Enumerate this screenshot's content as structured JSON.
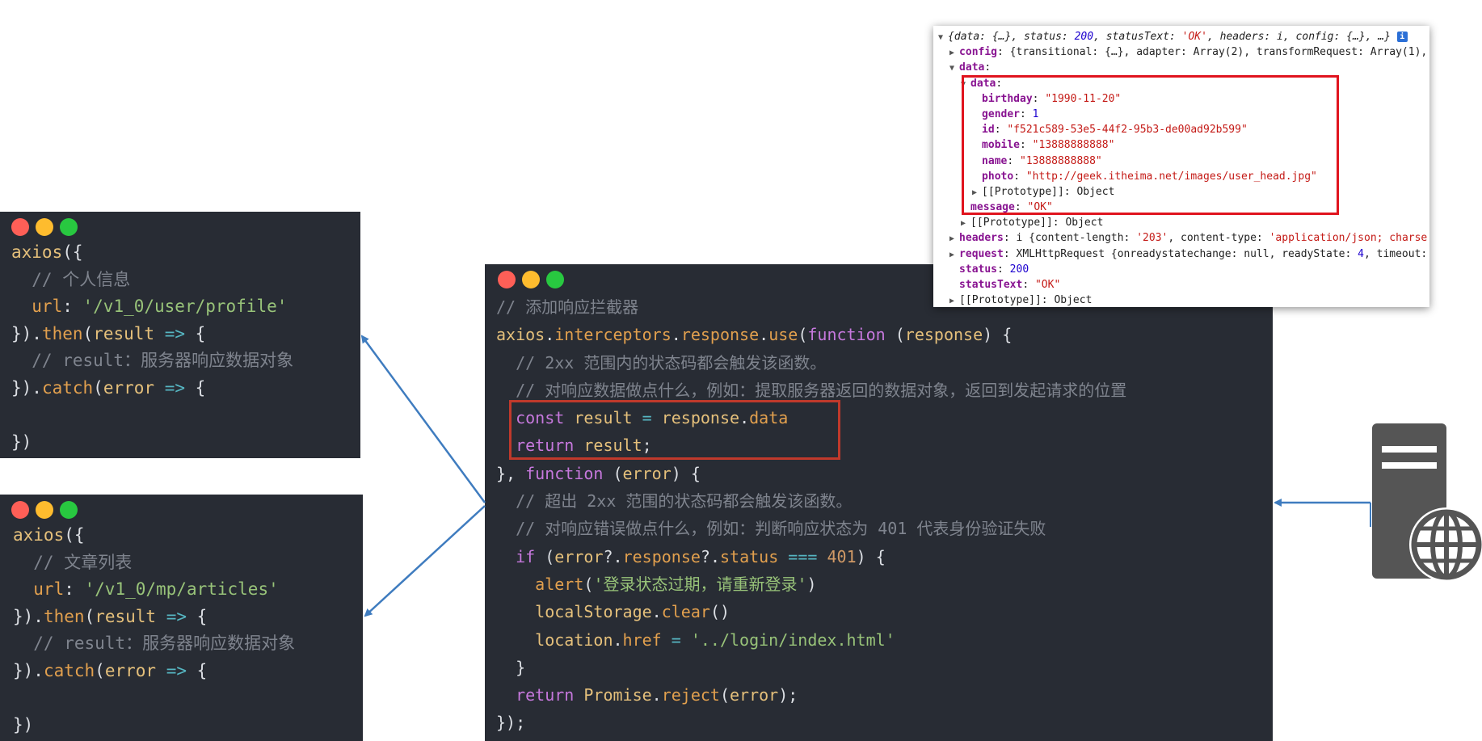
{
  "code_top": [
    [
      {
        "t": "axios",
        "c": "yellow"
      },
      {
        "t": "({",
        "c": "white"
      }
    ],
    [
      {
        "t": "  // 个人信息",
        "c": "comment"
      }
    ],
    [
      {
        "t": "  url",
        "c": "orange"
      },
      {
        "t": ": ",
        "c": "white"
      },
      {
        "t": "'/v1_0/user/profile'",
        "c": "green"
      }
    ],
    [
      {
        "t": "})",
        "c": "white"
      },
      {
        "t": ".",
        "c": "white"
      },
      {
        "t": "then",
        "c": "orange"
      },
      {
        "t": "(",
        "c": "white"
      },
      {
        "t": "result",
        "c": "yellow"
      },
      {
        "t": " => ",
        "c": "cyan"
      },
      {
        "t": "{",
        "c": "white"
      }
    ],
    [
      {
        "t": "  // result：服务器响应数据对象",
        "c": "comment"
      }
    ],
    [
      {
        "t": "})",
        "c": "white"
      },
      {
        "t": ".",
        "c": "white"
      },
      {
        "t": "catch",
        "c": "orange"
      },
      {
        "t": "(",
        "c": "white"
      },
      {
        "t": "error",
        "c": "yellow"
      },
      {
        "t": " => ",
        "c": "cyan"
      },
      {
        "t": "{",
        "c": "white"
      }
    ],
    [
      {
        "t": " ",
        "c": "white"
      }
    ],
    [
      {
        "t": "})",
        "c": "white"
      }
    ]
  ],
  "code_bottom": [
    [
      {
        "t": "axios",
        "c": "yellow"
      },
      {
        "t": "({",
        "c": "white"
      }
    ],
    [
      {
        "t": "  // 文章列表",
        "c": "comment"
      }
    ],
    [
      {
        "t": "  url",
        "c": "orange"
      },
      {
        "t": ": ",
        "c": "white"
      },
      {
        "t": "'/v1_0/mp/articles'",
        "c": "green"
      }
    ],
    [
      {
        "t": "})",
        "c": "white"
      },
      {
        "t": ".",
        "c": "white"
      },
      {
        "t": "then",
        "c": "orange"
      },
      {
        "t": "(",
        "c": "white"
      },
      {
        "t": "result",
        "c": "yellow"
      },
      {
        "t": " => ",
        "c": "cyan"
      },
      {
        "t": "{",
        "c": "white"
      }
    ],
    [
      {
        "t": "  // result：服务器响应数据对象",
        "c": "comment"
      }
    ],
    [
      {
        "t": "})",
        "c": "white"
      },
      {
        "t": ".",
        "c": "white"
      },
      {
        "t": "catch",
        "c": "orange"
      },
      {
        "t": "(",
        "c": "white"
      },
      {
        "t": "error",
        "c": "yellow"
      },
      {
        "t": " => ",
        "c": "cyan"
      },
      {
        "t": "{",
        "c": "white"
      }
    ],
    [
      {
        "t": " ",
        "c": "white"
      }
    ],
    [
      {
        "t": "})",
        "c": "white"
      }
    ]
  ],
  "code_main": [
    [
      {
        "t": "// 添加响应拦截器",
        "c": "comment"
      }
    ],
    [
      {
        "t": "axios",
        "c": "yellow"
      },
      {
        "t": ".",
        "c": "white"
      },
      {
        "t": "interceptors",
        "c": "orange"
      },
      {
        "t": ".",
        "c": "white"
      },
      {
        "t": "response",
        "c": "orange"
      },
      {
        "t": ".",
        "c": "white"
      },
      {
        "t": "use",
        "c": "orange"
      },
      {
        "t": "(",
        "c": "white"
      },
      {
        "t": "function",
        "c": "purple"
      },
      {
        "t": " (",
        "c": "white"
      },
      {
        "t": "response",
        "c": "yellow"
      },
      {
        "t": ") {",
        "c": "white"
      }
    ],
    [
      {
        "t": "  // 2xx 范围内的状态码都会触发该函数。",
        "c": "comment"
      }
    ],
    [
      {
        "t": "  // 对响应数据做点什么，例如：提取服务器返回的数据对象，返回到发起请求的位置",
        "c": "comment"
      }
    ],
    [
      {
        "t": "  ",
        "c": "white"
      },
      {
        "t": "const",
        "c": "purple"
      },
      {
        "t": " result ",
        "c": "yellow"
      },
      {
        "t": "=",
        "c": "cyan"
      },
      {
        "t": " response",
        "c": "yellow"
      },
      {
        "t": ".",
        "c": "white"
      },
      {
        "t": "data",
        "c": "orange"
      }
    ],
    [
      {
        "t": "  ",
        "c": "white"
      },
      {
        "t": "return",
        "c": "purple"
      },
      {
        "t": " result",
        "c": "yellow"
      },
      {
        "t": ";",
        "c": "white"
      }
    ],
    [
      {
        "t": "}, ",
        "c": "white"
      },
      {
        "t": "function",
        "c": "purple"
      },
      {
        "t": " (",
        "c": "white"
      },
      {
        "t": "error",
        "c": "yellow"
      },
      {
        "t": ") {",
        "c": "white"
      }
    ],
    [
      {
        "t": "  // 超出 2xx 范围的状态码都会触发该函数。",
        "c": "comment"
      }
    ],
    [
      {
        "t": "  // 对响应错误做点什么，例如：判断响应状态为 401 代表身份验证失败",
        "c": "comment"
      }
    ],
    [
      {
        "t": "  ",
        "c": "white"
      },
      {
        "t": "if",
        "c": "purple"
      },
      {
        "t": " (",
        "c": "white"
      },
      {
        "t": "error",
        "c": "yellow"
      },
      {
        "t": "?.",
        "c": "white"
      },
      {
        "t": "response",
        "c": "orange"
      },
      {
        "t": "?.",
        "c": "white"
      },
      {
        "t": "status",
        "c": "orange"
      },
      {
        "t": " === ",
        "c": "cyan"
      },
      {
        "t": "401",
        "c": "num"
      },
      {
        "t": ") {",
        "c": "white"
      }
    ],
    [
      {
        "t": "    ",
        "c": "white"
      },
      {
        "t": "alert",
        "c": "orange"
      },
      {
        "t": "(",
        "c": "white"
      },
      {
        "t": "'登录状态过期，请重新登录'",
        "c": "green"
      },
      {
        "t": ")",
        "c": "white"
      }
    ],
    [
      {
        "t": "    ",
        "c": "white"
      },
      {
        "t": "localStorage",
        "c": "yellow"
      },
      {
        "t": ".",
        "c": "white"
      },
      {
        "t": "clear",
        "c": "orange"
      },
      {
        "t": "()",
        "c": "white"
      }
    ],
    [
      {
        "t": "    ",
        "c": "white"
      },
      {
        "t": "location",
        "c": "yellow"
      },
      {
        "t": ".",
        "c": "white"
      },
      {
        "t": "href",
        "c": "orange"
      },
      {
        "t": " = ",
        "c": "cyan"
      },
      {
        "t": "'../login/index.html'",
        "c": "green"
      }
    ],
    [
      {
        "t": "  }",
        "c": "white"
      }
    ],
    [
      {
        "t": "  ",
        "c": "white"
      },
      {
        "t": "return",
        "c": "purple"
      },
      {
        "t": " Promise",
        "c": "yellow"
      },
      {
        "t": ".",
        "c": "white"
      },
      {
        "t": "reject",
        "c": "orange"
      },
      {
        "t": "(",
        "c": "white"
      },
      {
        "t": "error",
        "c": "yellow"
      },
      {
        "t": ");",
        "c": "white"
      }
    ],
    [
      {
        "t": "});",
        "c": "white"
      }
    ]
  ],
  "devtools": [
    {
      "i": 0,
      "tri": "▼",
      "p": [
        {
          "t": "{data: {…}, status: ",
          "c": "it"
        },
        {
          "t": "200",
          "c": "num-it"
        },
        {
          "t": ", statusText: ",
          "c": "it"
        },
        {
          "t": "'OK'",
          "c": "str-it"
        },
        {
          "t": ", headers: i, config: {…}, …}",
          "c": "it"
        }
      ],
      "badge": "i"
    },
    {
      "i": 1,
      "tri": "▶",
      "p": [
        {
          "t": "config",
          "c": "key"
        },
        {
          "t": ": {transitional: {…}, adapter: Array(2), transformRequest: Array(1),",
          "c": "plain"
        }
      ]
    },
    {
      "i": 1,
      "tri": "▼",
      "p": [
        {
          "t": "data",
          "c": "key"
        },
        {
          "t": ":",
          "c": "plain"
        }
      ]
    },
    {
      "i": 2,
      "tri": "▼",
      "p": [
        {
          "t": "data",
          "c": "key"
        },
        {
          "t": ":",
          "c": "plain"
        }
      ]
    },
    {
      "i": 3,
      "tri": "",
      "p": [
        {
          "t": "birthday",
          "c": "key"
        },
        {
          "t": ": ",
          "c": "plain"
        },
        {
          "t": "\"1990-11-20\"",
          "c": "str"
        }
      ]
    },
    {
      "i": 3,
      "tri": "",
      "p": [
        {
          "t": "gender",
          "c": "key"
        },
        {
          "t": ": ",
          "c": "plain"
        },
        {
          "t": "1",
          "c": "num"
        }
      ]
    },
    {
      "i": 3,
      "tri": "",
      "p": [
        {
          "t": "id",
          "c": "key"
        },
        {
          "t": ": ",
          "c": "plain"
        },
        {
          "t": "\"f521c589-53e5-44f2-95b3-de00ad92b599\"",
          "c": "str"
        }
      ]
    },
    {
      "i": 3,
      "tri": "",
      "p": [
        {
          "t": "mobile",
          "c": "key"
        },
        {
          "t": ": ",
          "c": "plain"
        },
        {
          "t": "\"13888888888\"",
          "c": "str"
        }
      ]
    },
    {
      "i": 3,
      "tri": "",
      "p": [
        {
          "t": "name",
          "c": "key"
        },
        {
          "t": ": ",
          "c": "plain"
        },
        {
          "t": "\"13888888888\"",
          "c": "str"
        }
      ]
    },
    {
      "i": 3,
      "tri": "",
      "p": [
        {
          "t": "photo",
          "c": "key"
        },
        {
          "t": ": ",
          "c": "plain"
        },
        {
          "t": "\"http://geek.itheima.net/images/user_head.jpg\"",
          "c": "str"
        }
      ]
    },
    {
      "i": 3,
      "tri": "▶",
      "p": [
        {
          "t": "[[Prototype]]: Object",
          "c": "plain"
        }
      ]
    },
    {
      "i": 2,
      "tri": "",
      "p": [
        {
          "t": "message",
          "c": "key"
        },
        {
          "t": ": ",
          "c": "plain"
        },
        {
          "t": "\"OK\"",
          "c": "str"
        }
      ]
    },
    {
      "i": 2,
      "tri": "▶",
      "p": [
        {
          "t": "[[Prototype]]: Object",
          "c": "plain"
        }
      ]
    },
    {
      "i": 1,
      "tri": "▶",
      "p": [
        {
          "t": "headers",
          "c": "key"
        },
        {
          "t": ": i {content-length: ",
          "c": "plain"
        },
        {
          "t": "'203'",
          "c": "str"
        },
        {
          "t": ", content-type: ",
          "c": "plain"
        },
        {
          "t": "'application/json; charse",
          "c": "str"
        }
      ]
    },
    {
      "i": 1,
      "tri": "▶",
      "p": [
        {
          "t": "request",
          "c": "key"
        },
        {
          "t": ": XMLHttpRequest {onreadystatechange: null, readyState: ",
          "c": "plain"
        },
        {
          "t": "4",
          "c": "num"
        },
        {
          "t": ", timeout:",
          "c": "plain"
        }
      ]
    },
    {
      "i": 1,
      "tri": "",
      "p": [
        {
          "t": "status",
          "c": "key"
        },
        {
          "t": ": ",
          "c": "plain"
        },
        {
          "t": "200",
          "c": "num"
        }
      ]
    },
    {
      "i": 1,
      "tri": "",
      "p": [
        {
          "t": "statusText",
          "c": "key"
        },
        {
          "t": ": ",
          "c": "plain"
        },
        {
          "t": "\"OK\"",
          "c": "str"
        }
      ]
    },
    {
      "i": 1,
      "tri": "▶",
      "p": [
        {
          "t": "[[Prototype]]: Object",
          "c": "plain"
        }
      ]
    }
  ],
  "colors": {
    "panel_bg": "#282c34",
    "highlight_red": "#c0392b",
    "devtools_box_red": "#e0141e",
    "arrow_blue": "#3f7cbf",
    "server_gray": "#555555"
  },
  "icons": [
    "window-dots-icon",
    "server-globe-icon"
  ]
}
